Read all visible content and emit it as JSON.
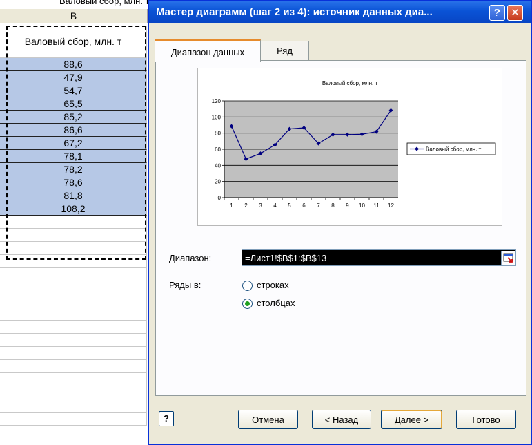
{
  "formula_bar": {
    "text": "Валовый сбор, млн. т"
  },
  "sheet": {
    "column_header": "B",
    "header_cell": "Валовый сбор, млн. т",
    "cells": [
      "88,6",
      "47,9",
      "54,7",
      "65,5",
      "85,2",
      "86,6",
      "67,2",
      "78,1",
      "78,2",
      "78,6",
      "81,8",
      "108,2"
    ],
    "empty_rows": 16,
    "selection_color": "#b6c8e6"
  },
  "dialog": {
    "title": "Мастер диаграмм (шаг 2 из 4): источник данных диа...",
    "help_glyph": "?",
    "close_glyph": "✕",
    "tabs": [
      {
        "label": "Диапазон данных",
        "active": true
      },
      {
        "label": "Ряд",
        "active": false
      }
    ],
    "range_label": "Диапазон:",
    "range_value": "=Лист1!$B$1:$B$13",
    "series_in_label": "Ряды в:",
    "radio_rows": "строках",
    "radio_columns": "столбцах",
    "selected_radio": "columns",
    "buttons": {
      "help": "?",
      "cancel": "Отмена",
      "back": "< Назад",
      "next": "Далее >",
      "finish": "Готово"
    },
    "accent": "#0a53d6"
  },
  "chart_data": {
    "type": "line",
    "title": "Валовый сбор, млн. т",
    "x": [
      1,
      2,
      3,
      4,
      5,
      6,
      7,
      8,
      9,
      10,
      11,
      12
    ],
    "series": [
      {
        "name": "Валовый сбор, млн. т",
        "values": [
          88.6,
          47.9,
          54.7,
          65.5,
          85.2,
          86.6,
          67.2,
          78.1,
          78.2,
          78.6,
          81.8,
          108.2
        ]
      }
    ],
    "ylim": [
      0,
      120
    ],
    "yticks": [
      0,
      20,
      40,
      60,
      80,
      100,
      120
    ],
    "grid": true,
    "plot_background": "#c0c0c0",
    "line_color": "#000080",
    "legend": "right"
  }
}
